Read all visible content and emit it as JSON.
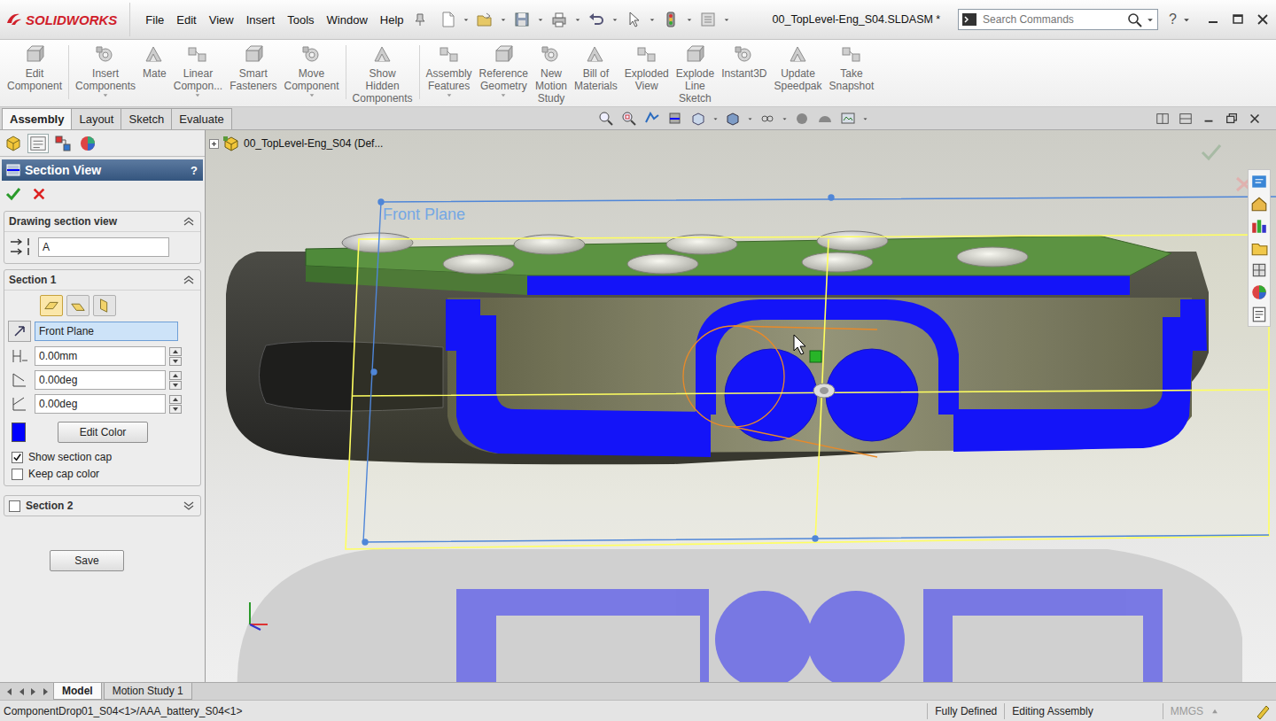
{
  "window": {
    "app": "SOLIDWORKS",
    "title": "00_TopLevel-Eng_S04.SLDASM *"
  },
  "menu": [
    "File",
    "Edit",
    "View",
    "Insert",
    "Tools",
    "Window",
    "Help"
  ],
  "search": {
    "placeholder": "Search Commands"
  },
  "help": "?",
  "ribbon": [
    {
      "lines": [
        "Edit",
        "Component"
      ],
      "dropdown": false
    },
    {
      "lines": [
        "Insert",
        "Components"
      ],
      "dropdown": true
    },
    {
      "lines": [
        "Mate"
      ],
      "dropdown": false
    },
    {
      "lines": [
        "Linear",
        "Compon..."
      ],
      "dropdown": true
    },
    {
      "lines": [
        "Smart",
        "Fasteners"
      ],
      "dropdown": false
    },
    {
      "lines": [
        "Move",
        "Component"
      ],
      "dropdown": true
    },
    {
      "lines": [
        "Show",
        "Hidden",
        "Components"
      ],
      "dropdown": false
    },
    {
      "lines": [
        "Assembly",
        "Features"
      ],
      "dropdown": true
    },
    {
      "lines": [
        "Reference",
        "Geometry"
      ],
      "dropdown": true
    },
    {
      "lines": [
        "New",
        "Motion",
        "Study"
      ],
      "dropdown": false
    },
    {
      "lines": [
        "Bill of",
        "Materials"
      ],
      "dropdown": false
    },
    {
      "lines": [
        "Exploded",
        "View"
      ],
      "dropdown": false
    },
    {
      "lines": [
        "Explode",
        "Line",
        "Sketch"
      ],
      "dropdown": false
    },
    {
      "lines": [
        "Instant3D"
      ],
      "dropdown": false
    },
    {
      "lines": [
        "Update",
        "Speedpak"
      ],
      "dropdown": false
    },
    {
      "lines": [
        "Take",
        "Snapshot"
      ],
      "dropdown": false
    }
  ],
  "tabs": [
    {
      "label": "Assembly",
      "selected": true
    },
    {
      "label": "Layout",
      "selected": false
    },
    {
      "label": "Sketch",
      "selected": false
    },
    {
      "label": "Evaluate",
      "selected": false
    }
  ],
  "tree": {
    "root": "00_TopLevel-Eng_S04  (Def..."
  },
  "panel": {
    "title": "Section View",
    "help": "?",
    "drawing_section": {
      "title": "Drawing section view",
      "value": "A"
    },
    "section1": {
      "title": "Section 1",
      "plane_buttons": [
        {
          "selected": true
        },
        {
          "selected": false
        },
        {
          "selected": false
        }
      ],
      "reference": "Front Plane",
      "fields": [
        "0.00mm",
        "0.00deg",
        "0.00deg"
      ],
      "color": "#0000ff",
      "edit_color": "Edit Color",
      "options": [
        {
          "label": "Show section cap",
          "checked": true
        },
        {
          "label": "Keep cap color",
          "checked": false
        }
      ]
    },
    "section2": {
      "title": "Section 2",
      "checked": false,
      "expanded": false
    },
    "save": "Save"
  },
  "viewport": {
    "plane_label": "Front Plane"
  },
  "bottom_tabs": [
    {
      "label": "Model",
      "selected": true
    },
    {
      "label": "Motion Study 1",
      "selected": false
    }
  ],
  "status_bar": {
    "component": "ComponentDrop01_S04<1>/AAA_battery_S04<1>",
    "cells": [
      "Fully Defined",
      "Editing Assembly",
      "MMGS"
    ]
  }
}
